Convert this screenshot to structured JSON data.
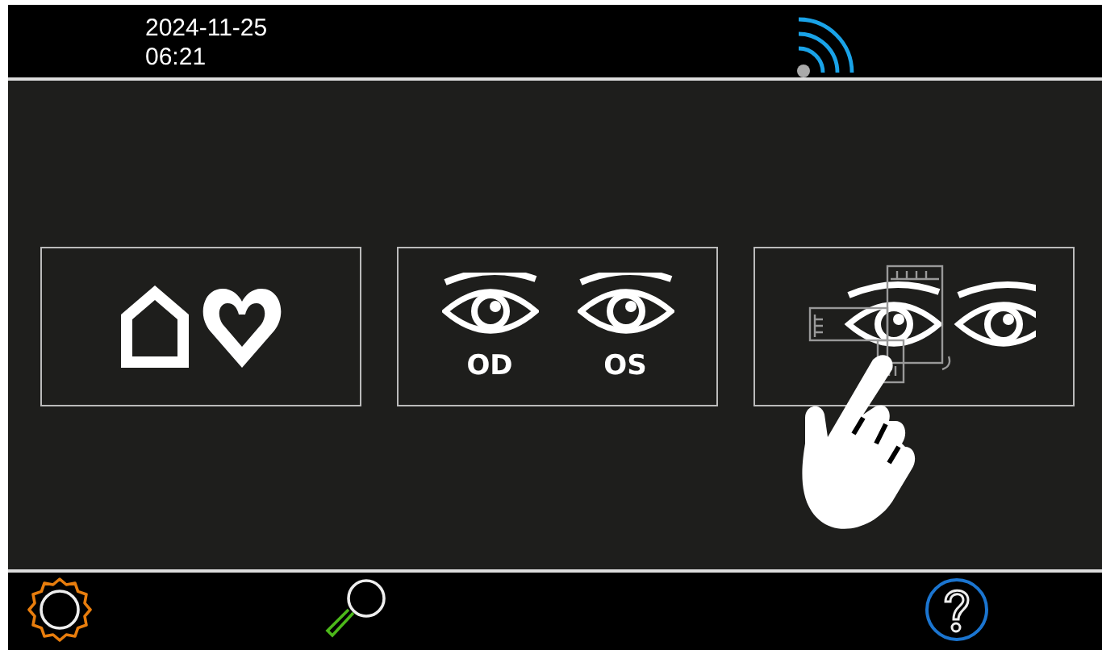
{
  "status_bar": {
    "date": "2024-11-25",
    "time": "06:21"
  },
  "tiles": [
    {
      "kind": "home-heart"
    },
    {
      "kind": "eyes",
      "labels": [
        "OD",
        "OS"
      ]
    },
    {
      "kind": "measure"
    }
  ],
  "toolbar": [
    {
      "kind": "settings"
    },
    {
      "kind": "search"
    },
    {
      "kind": "help"
    }
  ]
}
